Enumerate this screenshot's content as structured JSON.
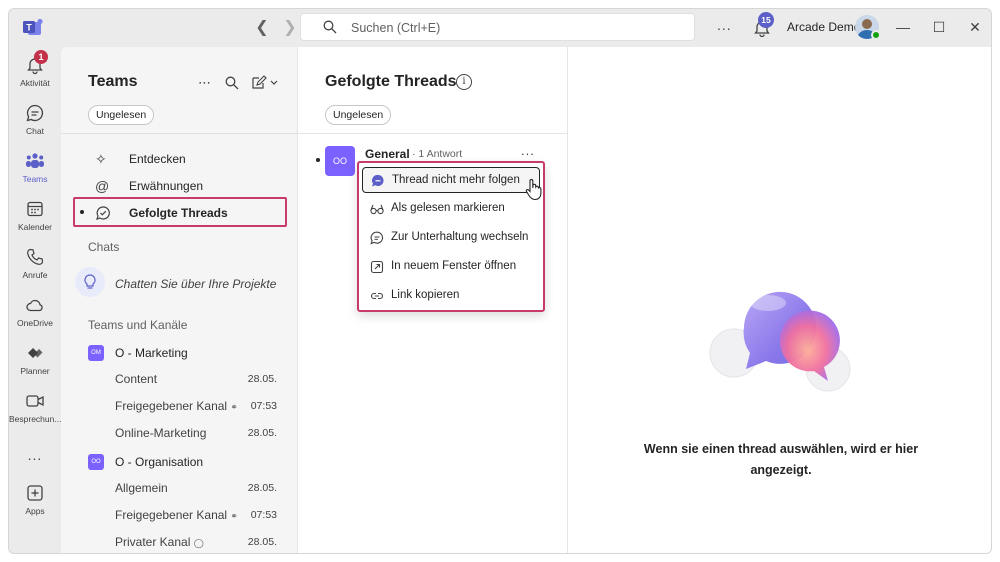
{
  "titlebar": {
    "search_placeholder": "Suchen (Ctrl+E)",
    "more": "...",
    "notification_count": "15",
    "user_name": "Arcade Demo"
  },
  "rail": {
    "items": [
      {
        "label": "Aktivität",
        "icon": "bell-icon",
        "badge": "1"
      },
      {
        "label": "Chat",
        "icon": "chat-icon"
      },
      {
        "label": "Teams",
        "icon": "teams-icon"
      },
      {
        "label": "Kalender",
        "icon": "calendar-icon"
      },
      {
        "label": "Anrufe",
        "icon": "phone-icon"
      },
      {
        "label": "OneDrive",
        "icon": "cloud-icon"
      },
      {
        "label": "Planner",
        "icon": "planner-icon"
      },
      {
        "label": "Besprechun...",
        "icon": "video-icon"
      },
      {
        "label": "Apps",
        "icon": "add-apps-icon"
      }
    ],
    "more": "..."
  },
  "leftpane": {
    "title": "Teams",
    "filter_chip": "Ungelesen",
    "nav": [
      {
        "label": "Entdecken",
        "icon": "discover-icon"
      },
      {
        "label": "Erwähnungen",
        "icon": "at-icon"
      },
      {
        "label": "Gefolgte Threads",
        "icon": "followed-threads-icon"
      }
    ],
    "chats_header": "Chats",
    "promo_text": "Chatten Sie über Ihre Projekte",
    "teams_header": "Teams und Kanäle",
    "teams": [
      {
        "name": "O - Marketing",
        "tile": "OM",
        "channels": [
          {
            "name": "Content",
            "time": "28.05."
          },
          {
            "name": "Freigegebener Kanal",
            "time": "07:53"
          },
          {
            "name": "Online-Marketing",
            "time": "28.05."
          }
        ]
      },
      {
        "name": "O - Organisation",
        "tile": "OO",
        "channels": [
          {
            "name": "Allgemein",
            "time": "28.05."
          },
          {
            "name": "Freigegebener Kanal",
            "time": "07:53"
          },
          {
            "name": "Privater Kanal",
            "time": "28.05."
          }
        ]
      }
    ]
  },
  "midpane": {
    "title": "Gefolgte Threads",
    "filter_chip": "Ungelesen",
    "thread": {
      "tile": "OO",
      "channel": "General",
      "meta": "· 1 Antwort",
      "more": "..."
    }
  },
  "menu": {
    "items": [
      {
        "label": "Thread nicht mehr folgen",
        "icon": "unfollow-icon"
      },
      {
        "label": "Als gelesen markieren",
        "icon": "glasses-icon"
      },
      {
        "label": "Zur Unterhaltung wechseln",
        "icon": "chat-bubble-icon"
      },
      {
        "label": "In neuem Fenster öffnen",
        "icon": "open-window-icon"
      },
      {
        "label": "Link kopieren",
        "icon": "link-icon"
      }
    ]
  },
  "rightpane": {
    "empty_message": "Wenn sie einen thread auswählen, wird er hier angezeigt."
  },
  "colors": {
    "brand": "#5b5fc7",
    "highlight": "#c83a6c",
    "team_tile": "#7b61ff",
    "badge_red": "#c4314b"
  }
}
